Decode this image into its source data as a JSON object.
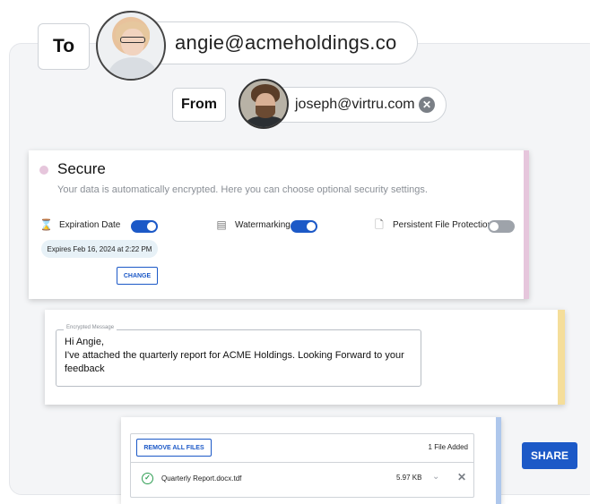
{
  "recipient": {
    "label": "To",
    "email": "angie@acmeholdings.co"
  },
  "sender": {
    "label": "From",
    "email": "joseph@virtru.com",
    "clear_icon": "close-circle-icon"
  },
  "security": {
    "title": "Secure",
    "subtitle": "Your data is automatically encrypted. Here you can choose optional security settings.",
    "accent_color": "#e6c6dc",
    "options": [
      {
        "label": "Expiration Date",
        "icon": "hourglass-icon",
        "enabled": true
      },
      {
        "label": "Watermarking",
        "icon": "document-icon",
        "enabled": true
      },
      {
        "label": "Persistent File Protection",
        "icon": "file-lock-icon",
        "enabled": false
      }
    ],
    "expiry_text": "Expires Feb 16, 2024 at 2:22 PM",
    "change_label": "CHANGE"
  },
  "message": {
    "legend": "Encrypted Message",
    "body": "Hi Angie,\nI've attached the quarterly report for ACME Holdings. Looking Forward to your feedback",
    "accent_color": "#f5de9a"
  },
  "attachments": {
    "remove_label": "REMOVE ALL FILES",
    "count_label": "1 File Added",
    "accent_color": "#aec7ec",
    "files": [
      {
        "name": "Quarterly Report.docx.tdf",
        "size": "5.97 KB"
      }
    ]
  },
  "actions": {
    "share_label": "SHARE",
    "primary_color": "#1c59c7"
  }
}
